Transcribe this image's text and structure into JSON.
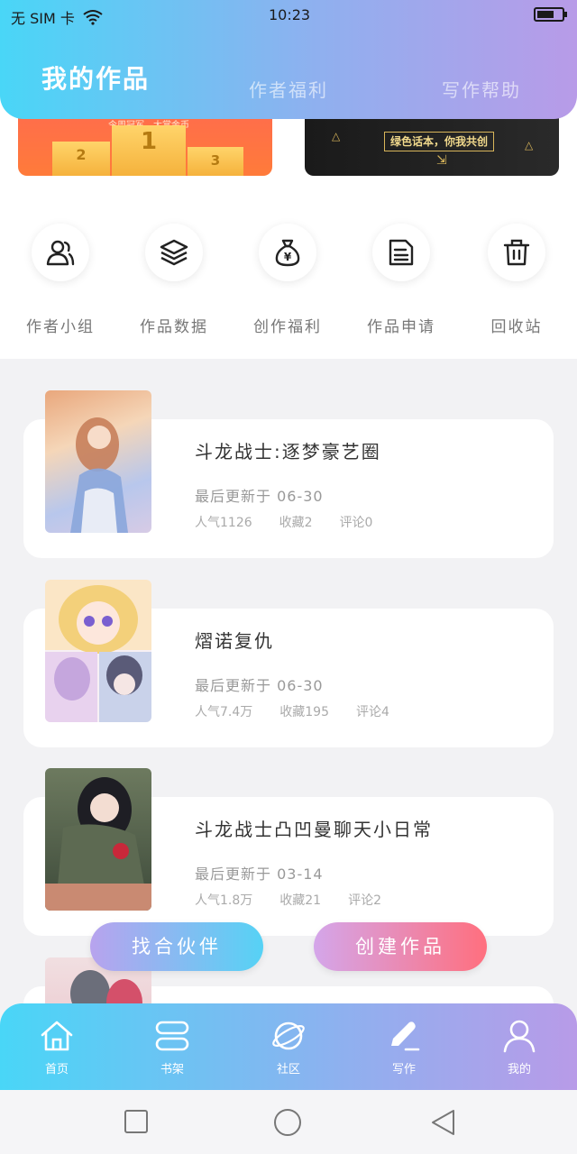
{
  "status_bar": {
    "carrier": "无 SIM 卡",
    "time": "10:23"
  },
  "tabs": [
    {
      "label": "我的作品",
      "active": true
    },
    {
      "label": "作者福利",
      "active": false
    },
    {
      "label": "写作帮助",
      "active": false
    }
  ],
  "banners": {
    "left": {
      "caption": "今周冠军，大赏金币",
      "places": [
        "2",
        "1",
        "3"
      ]
    },
    "right": {
      "slogan": "绿色话本，你我共创"
    }
  },
  "features": [
    {
      "label": "作者小组",
      "icon": "group-icon"
    },
    {
      "label": "作品数据",
      "icon": "layers-icon"
    },
    {
      "label": "创作福利",
      "icon": "money-bag-icon"
    },
    {
      "label": "作品申请",
      "icon": "document-icon"
    },
    {
      "label": "回收站",
      "icon": "trash-icon"
    }
  ],
  "works": [
    {
      "title": "斗龙战士:逐梦豪艺圈",
      "updated": "最后更新于 06-30",
      "popularity": "人气1126",
      "favorites": "收藏2",
      "comments": "评论0"
    },
    {
      "title": "熠诺复仇",
      "updated": "最后更新于 06-30",
      "popularity": "人气7.4万",
      "favorites": "收藏195",
      "comments": "评论4"
    },
    {
      "title": "斗龙战士凸凹曼聊天小日常",
      "updated": "最后更新于 03-14",
      "popularity": "人气1.8万",
      "favorites": "收藏21",
      "comments": "评论2"
    }
  ],
  "actions": {
    "partner": "找合伙伴",
    "create": "创建作品"
  },
  "bottom_nav": [
    {
      "label": "首页",
      "icon": "home-icon"
    },
    {
      "label": "书架",
      "icon": "bookshelf-icon"
    },
    {
      "label": "社区",
      "icon": "planet-icon"
    },
    {
      "label": "写作",
      "icon": "pen-icon",
      "active": true
    },
    {
      "label": "我的",
      "icon": "user-icon"
    }
  ],
  "colors": {
    "header_start": "#49d6f7",
    "header_end": "#b89be8",
    "create_button": "#ff6f7e",
    "partner_button": "#56d2f5"
  }
}
